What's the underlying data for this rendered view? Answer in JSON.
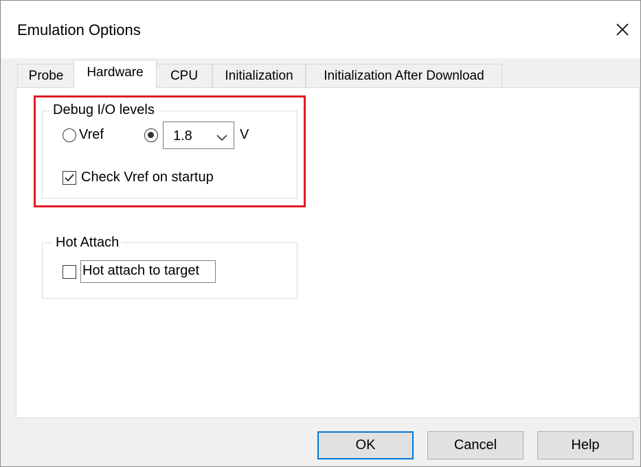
{
  "window": {
    "title": "Emulation Options",
    "close_icon": "close-icon"
  },
  "tabs": [
    {
      "label": "Probe",
      "active": false
    },
    {
      "label": "Hardware",
      "active": true
    },
    {
      "label": "CPU",
      "active": false
    },
    {
      "label": "Initialization",
      "active": false
    },
    {
      "label": "Initialization After Download",
      "active": false
    }
  ],
  "debug_io": {
    "group_label": "Debug I/O levels",
    "vref_label": "Vref",
    "vref_selected": false,
    "fixed_selected": true,
    "voltage_value": "1.8",
    "unit_label": "V",
    "check_vref_label": "Check Vref on startup",
    "check_vref_checked": true
  },
  "hot_attach": {
    "group_label": "Hot Attach",
    "hot_attach_label": "Hot attach to target",
    "hot_attach_checked": false
  },
  "buttons": {
    "ok": "OK",
    "cancel": "Cancel",
    "help": "Help"
  },
  "colors": {
    "highlight": "#e01b24",
    "default_button_border": "#0078d7"
  }
}
